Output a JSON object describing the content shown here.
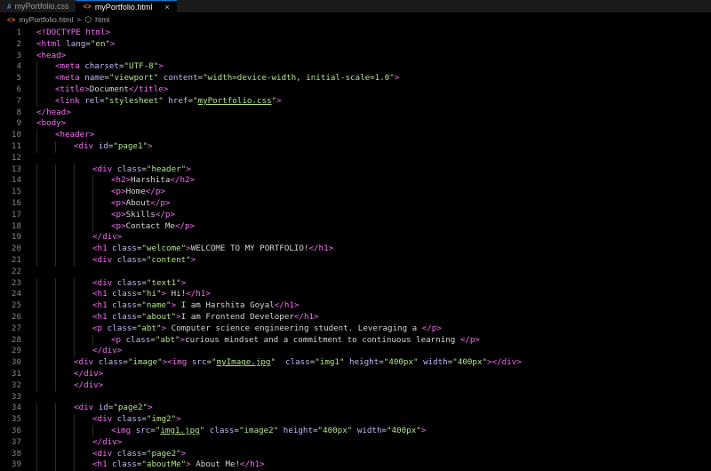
{
  "tabs": [
    {
      "icon": "#",
      "label": "myPortfolio.css",
      "active": false
    },
    {
      "icon": "<>",
      "label": "myPortfolio.html",
      "active": true,
      "close": "×"
    }
  ],
  "breadcrumb": {
    "file": "myPortfolio.html",
    "separator": ">",
    "element": "html"
  },
  "colors": {
    "tag": "#f56cf4",
    "attr": "#c4b7f4",
    "string": "#b4e28c",
    "text": "#d4d4d4",
    "bracket": "#a0a0a0",
    "line_number": "#858585",
    "background": "#000000"
  },
  "lines": [
    {
      "n": "1",
      "indent": 0,
      "tokens": [
        [
          "t",
          "<!DOCTYPE"
        ],
        [
          "c",
          " "
        ],
        [
          "t",
          "html"
        ],
        [
          "t",
          ">"
        ]
      ]
    },
    {
      "n": "2",
      "indent": 0,
      "tokens": [
        [
          "t",
          "<html"
        ],
        [
          "c",
          " "
        ],
        [
          "a",
          "lang"
        ],
        [
          "c",
          "="
        ],
        [
          "s",
          "\"en\""
        ],
        [
          "t",
          ">"
        ]
      ]
    },
    {
      "n": "3",
      "indent": 0,
      "tokens": [
        [
          "t",
          "<head>"
        ]
      ]
    },
    {
      "n": "4",
      "indent": 1,
      "tokens": [
        [
          "t",
          "<meta"
        ],
        [
          "c",
          " "
        ],
        [
          "a",
          "charset"
        ],
        [
          "c",
          "="
        ],
        [
          "s",
          "\"UTF-8\""
        ],
        [
          "t",
          ">"
        ]
      ]
    },
    {
      "n": "5",
      "indent": 1,
      "tokens": [
        [
          "t",
          "<meta"
        ],
        [
          "c",
          " "
        ],
        [
          "a",
          "name"
        ],
        [
          "c",
          "="
        ],
        [
          "s",
          "\"viewport\""
        ],
        [
          "c",
          " "
        ],
        [
          "a",
          "content"
        ],
        [
          "c",
          "="
        ],
        [
          "s",
          "\"width=device-width, initial-scale=1.0\""
        ],
        [
          "t",
          ">"
        ]
      ]
    },
    {
      "n": "6",
      "indent": 1,
      "tokens": [
        [
          "t",
          "<title>"
        ],
        [
          "c",
          "Document"
        ],
        [
          "t",
          "</title>"
        ]
      ]
    },
    {
      "n": "7",
      "indent": 1,
      "tokens": [
        [
          "t",
          "<link"
        ],
        [
          "c",
          " "
        ],
        [
          "a",
          "rel"
        ],
        [
          "c",
          "="
        ],
        [
          "s",
          "\"stylesheet\""
        ],
        [
          "c",
          " "
        ],
        [
          "a",
          "href"
        ],
        [
          "c",
          "="
        ],
        [
          "s",
          "\""
        ],
        [
          "su",
          "myPortfolio.css"
        ],
        [
          "s",
          "\""
        ],
        [
          "t",
          ">"
        ]
      ]
    },
    {
      "n": "8",
      "indent": 0,
      "tokens": [
        [
          "t",
          "</head>"
        ]
      ]
    },
    {
      "n": "9",
      "indent": 0,
      "tokens": [
        [
          "t",
          "<body>"
        ]
      ]
    },
    {
      "n": "10",
      "indent": 1,
      "tokens": [
        [
          "t",
          "<header>"
        ]
      ]
    },
    {
      "n": "11",
      "indent": 2,
      "tokens": [
        [
          "t",
          "<div"
        ],
        [
          "c",
          " "
        ],
        [
          "a",
          "id"
        ],
        [
          "c",
          "="
        ],
        [
          "s",
          "\"page1\""
        ],
        [
          "t",
          ">"
        ]
      ]
    },
    {
      "n": "12",
      "indent": 0,
      "tokens": []
    },
    {
      "n": "13",
      "indent": 3,
      "tokens": [
        [
          "t",
          "<div"
        ],
        [
          "c",
          " "
        ],
        [
          "a",
          "class"
        ],
        [
          "c",
          "="
        ],
        [
          "s",
          "\"header\""
        ],
        [
          "t",
          ">"
        ]
      ]
    },
    {
      "n": "14",
      "indent": 4,
      "tokens": [
        [
          "t",
          "<h2>"
        ],
        [
          "c",
          "Harshita"
        ],
        [
          "t",
          "</h2>"
        ]
      ]
    },
    {
      "n": "15",
      "indent": 4,
      "tokens": [
        [
          "t",
          "<p>"
        ],
        [
          "c",
          "Home"
        ],
        [
          "t",
          "</p>"
        ]
      ]
    },
    {
      "n": "16",
      "indent": 4,
      "tokens": [
        [
          "t",
          "<p>"
        ],
        [
          "c",
          "About"
        ],
        [
          "t",
          "</p>"
        ]
      ]
    },
    {
      "n": "17",
      "indent": 4,
      "tokens": [
        [
          "t",
          "<p>"
        ],
        [
          "c",
          "Skills"
        ],
        [
          "t",
          "</p>"
        ]
      ]
    },
    {
      "n": "18",
      "indent": 4,
      "tokens": [
        [
          "t",
          "<p>"
        ],
        [
          "c",
          "Contact Me"
        ],
        [
          "t",
          "</p>"
        ]
      ]
    },
    {
      "n": "19",
      "indent": 3,
      "tokens": [
        [
          "t",
          "</div>"
        ]
      ]
    },
    {
      "n": "20",
      "indent": 3,
      "tokens": [
        [
          "t",
          "<h1"
        ],
        [
          "c",
          " "
        ],
        [
          "a",
          "class"
        ],
        [
          "c",
          "="
        ],
        [
          "s",
          "\"welcome\""
        ],
        [
          "t",
          ">"
        ],
        [
          "c",
          "WELCOME TO MY PORTFOLIO!"
        ],
        [
          "t",
          "</h1>"
        ]
      ]
    },
    {
      "n": "21",
      "indent": 3,
      "tokens": [
        [
          "t",
          "<div"
        ],
        [
          "c",
          " "
        ],
        [
          "a",
          "class"
        ],
        [
          "c",
          "="
        ],
        [
          "s",
          "\"content\""
        ],
        [
          "t",
          ">"
        ]
      ]
    },
    {
      "n": "22",
      "indent": 0,
      "tokens": []
    },
    {
      "n": "23",
      "indent": 3,
      "tokens": [
        [
          "t",
          "<div"
        ],
        [
          "c",
          " "
        ],
        [
          "a",
          "class"
        ],
        [
          "c",
          "="
        ],
        [
          "s",
          "\"text1\""
        ],
        [
          "t",
          ">"
        ]
      ]
    },
    {
      "n": "24",
      "indent": 3,
      "tokens": [
        [
          "t",
          "<h1"
        ],
        [
          "c",
          " "
        ],
        [
          "a",
          "class"
        ],
        [
          "c",
          "="
        ],
        [
          "s",
          "\"hi\""
        ],
        [
          "t",
          ">"
        ],
        [
          "c",
          " Hi!"
        ],
        [
          "t",
          "</h1>"
        ]
      ]
    },
    {
      "n": "25",
      "indent": 3,
      "tokens": [
        [
          "t",
          "<h1"
        ],
        [
          "c",
          " "
        ],
        [
          "a",
          "class"
        ],
        [
          "c",
          "="
        ],
        [
          "s",
          "\"name\""
        ],
        [
          "t",
          ">"
        ],
        [
          "c",
          " I am Harshita Goyal"
        ],
        [
          "t",
          "</h1>"
        ]
      ]
    },
    {
      "n": "26",
      "indent": 3,
      "tokens": [
        [
          "t",
          "<h1"
        ],
        [
          "c",
          " "
        ],
        [
          "a",
          "class"
        ],
        [
          "c",
          "="
        ],
        [
          "s",
          "\"about\""
        ],
        [
          "t",
          ">"
        ],
        [
          "c",
          "I am Frontend Developer"
        ],
        [
          "t",
          "</h1>"
        ]
      ]
    },
    {
      "n": "27",
      "indent": 3,
      "tokens": [
        [
          "t",
          "<p"
        ],
        [
          "c",
          " "
        ],
        [
          "a",
          "class"
        ],
        [
          "c",
          "="
        ],
        [
          "s",
          "\"abt\""
        ],
        [
          "t",
          ">"
        ],
        [
          "c",
          " Computer science engineering student. Leveraging a "
        ],
        [
          "t",
          "</p>"
        ]
      ]
    },
    {
      "n": "28",
      "indent": 4,
      "tokens": [
        [
          "t",
          "<p"
        ],
        [
          "c",
          " "
        ],
        [
          "a",
          "class"
        ],
        [
          "c",
          "="
        ],
        [
          "s",
          "\"abt\""
        ],
        [
          "t",
          ">"
        ],
        [
          "c",
          "curious mindset and a commitment to continuous learning "
        ],
        [
          "t",
          "</p>"
        ]
      ]
    },
    {
      "n": "29",
      "indent": 3,
      "tokens": [
        [
          "t",
          "</div>"
        ]
      ]
    },
    {
      "n": "30",
      "indent": 2,
      "tokens": [
        [
          "t",
          "<div"
        ],
        [
          "c",
          " "
        ],
        [
          "a",
          "class"
        ],
        [
          "c",
          "="
        ],
        [
          "s",
          "\"image\""
        ],
        [
          "t",
          ">"
        ],
        [
          "t",
          "<img"
        ],
        [
          "c",
          " "
        ],
        [
          "a",
          "src"
        ],
        [
          "c",
          "="
        ],
        [
          "s",
          "\""
        ],
        [
          "su",
          "myImage.jpg"
        ],
        [
          "s",
          "\""
        ],
        [
          "c",
          "  "
        ],
        [
          "a",
          "class"
        ],
        [
          "c",
          "="
        ],
        [
          "s",
          "\"img1\""
        ],
        [
          "c",
          " "
        ],
        [
          "a",
          "height"
        ],
        [
          "c",
          "="
        ],
        [
          "s",
          "\"400px\""
        ],
        [
          "c",
          " "
        ],
        [
          "a",
          "width"
        ],
        [
          "c",
          "="
        ],
        [
          "s",
          "\"400px\""
        ],
        [
          "t",
          ">"
        ],
        [
          "t",
          "</div>"
        ]
      ]
    },
    {
      "n": "31",
      "indent": 2,
      "tokens": [
        [
          "t",
          "</div>"
        ]
      ]
    },
    {
      "n": "32",
      "indent": 2,
      "tokens": [
        [
          "t",
          "</div>"
        ]
      ]
    },
    {
      "n": "33",
      "indent": 0,
      "tokens": []
    },
    {
      "n": "34",
      "indent": 2,
      "tokens": [
        [
          "t",
          "<div"
        ],
        [
          "c",
          " "
        ],
        [
          "a",
          "id"
        ],
        [
          "c",
          "="
        ],
        [
          "s",
          "\"page2\""
        ],
        [
          "t",
          ">"
        ]
      ]
    },
    {
      "n": "35",
      "indent": 3,
      "tokens": [
        [
          "t",
          "<div"
        ],
        [
          "c",
          " "
        ],
        [
          "a",
          "class"
        ],
        [
          "c",
          "="
        ],
        [
          "s",
          "\"img2\""
        ],
        [
          "t",
          ">"
        ]
      ]
    },
    {
      "n": "36",
      "indent": 4,
      "tokens": [
        [
          "t",
          "<img"
        ],
        [
          "c",
          " "
        ],
        [
          "a",
          "src"
        ],
        [
          "c",
          "="
        ],
        [
          "s",
          "\""
        ],
        [
          "su",
          "img1.jpg"
        ],
        [
          "s",
          "\""
        ],
        [
          "c",
          " "
        ],
        [
          "a",
          "class"
        ],
        [
          "c",
          "="
        ],
        [
          "s",
          "\"image2\""
        ],
        [
          "c",
          " "
        ],
        [
          "a",
          "height"
        ],
        [
          "c",
          "="
        ],
        [
          "s",
          "\"400px\""
        ],
        [
          "c",
          " "
        ],
        [
          "a",
          "width"
        ],
        [
          "c",
          "="
        ],
        [
          "s",
          "\"400px\""
        ],
        [
          "t",
          ">"
        ]
      ]
    },
    {
      "n": "37",
      "indent": 3,
      "tokens": [
        [
          "t",
          "</div>"
        ]
      ]
    },
    {
      "n": "38",
      "indent": 3,
      "tokens": [
        [
          "t",
          "<div"
        ],
        [
          "c",
          " "
        ],
        [
          "a",
          "class"
        ],
        [
          "c",
          "="
        ],
        [
          "s",
          "\"page2\""
        ],
        [
          "t",
          ">"
        ]
      ]
    },
    {
      "n": "39",
      "indent": 3,
      "tokens": [
        [
          "t",
          "<h1"
        ],
        [
          "c",
          " "
        ],
        [
          "a",
          "class"
        ],
        [
          "c",
          "="
        ],
        [
          "s",
          "\"aboutMe\""
        ],
        [
          "t",
          ">"
        ],
        [
          "c",
          " About Me!"
        ],
        [
          "t",
          "</h1>"
        ]
      ]
    }
  ]
}
